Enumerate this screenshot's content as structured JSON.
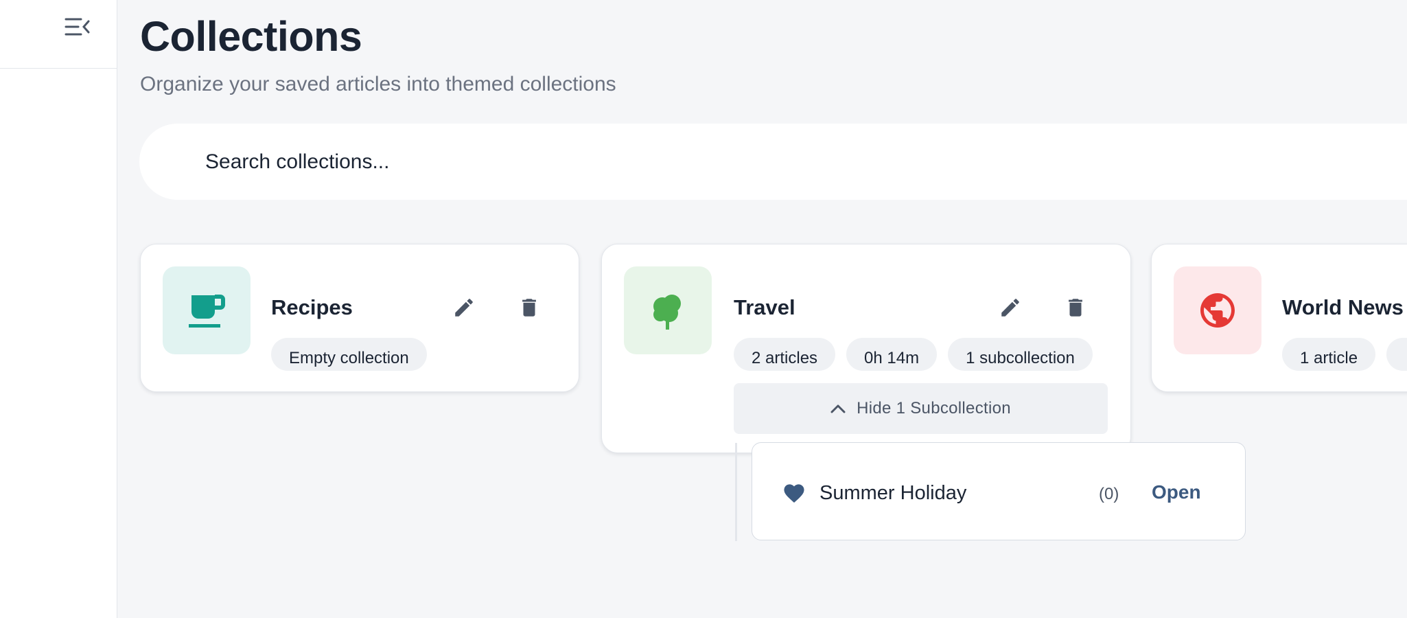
{
  "sidebar": {
    "toggle_icon": "menu-collapse-icon"
  },
  "header": {
    "title": "Collections",
    "subtitle": "Organize your saved articles into themed collections"
  },
  "search": {
    "placeholder": "Search collections..."
  },
  "collections": [
    {
      "name": "Recipes",
      "icon": "coffee-cup-icon",
      "icon_color": "#139e8c",
      "icon_bg": "#e1f3f1",
      "chips": [
        "Empty collection"
      ]
    },
    {
      "name": "Travel",
      "icon": "tree-icon",
      "icon_color": "#4caf50",
      "icon_bg": "#e8f5e9",
      "chips": [
        "2 articles",
        "0h 14m",
        "1 subcollection"
      ],
      "toggle_label": "Hide 1 Subcollection",
      "subcollections": [
        {
          "name": "Summer Holiday",
          "icon": "heart-icon",
          "count": "(0)",
          "action": "Open"
        }
      ]
    },
    {
      "name": "World News",
      "icon": "globe-icon",
      "icon_color": "#e53935",
      "icon_bg": "#fde8ea",
      "chips": [
        "1 article"
      ]
    }
  ],
  "colors": {
    "accent": "#3c5a80",
    "text": "#1b2433",
    "muted": "#6b7280"
  }
}
